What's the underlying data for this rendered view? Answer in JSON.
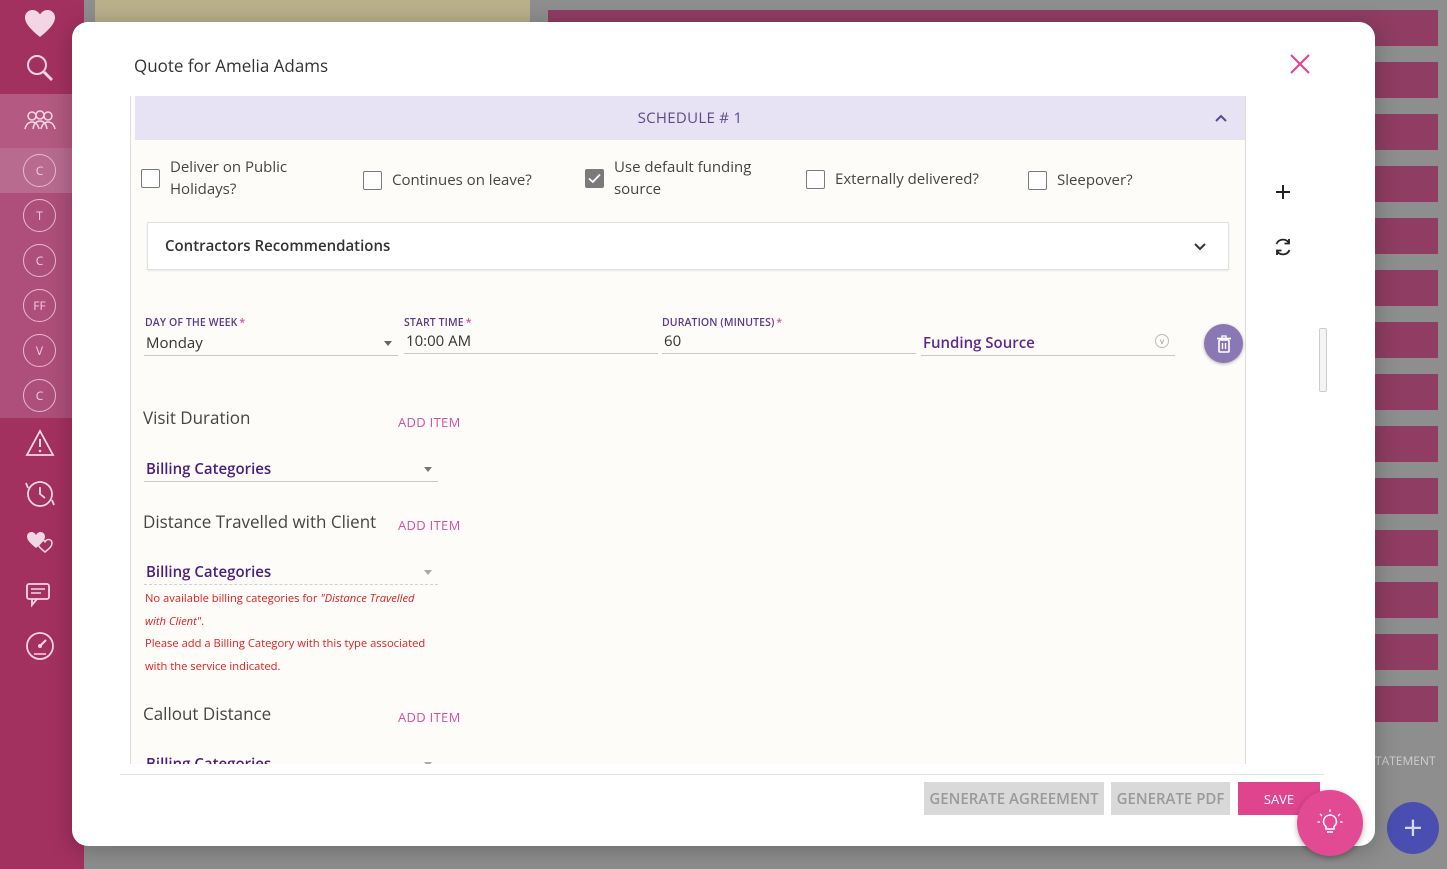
{
  "modal": {
    "title": "Quote for Amelia Adams"
  },
  "schedule": {
    "header": "SCHEDULE # 1",
    "checkboxes": [
      {
        "line1": "Deliver on Public",
        "line2": "Holidays?",
        "checked": false
      },
      {
        "line1": "Continues on leave?",
        "line2": "",
        "checked": false
      },
      {
        "line1": "Use default funding",
        "line2": "source",
        "checked": true
      },
      {
        "line1": "Externally delivered?",
        "line2": "",
        "checked": false
      },
      {
        "line1": "Sleepover?",
        "line2": "",
        "checked": false
      }
    ],
    "contractors_title": "Contractors Recommendations",
    "fields": {
      "day_label": "DAY OF THE WEEK",
      "day_value": "Monday",
      "start_label": "START TIME",
      "start_value": "10:00 AM",
      "duration_label": "DURATION (MINUTES)",
      "duration_value": "60",
      "funding_value": "Funding Source",
      "required_mark": "*"
    },
    "sections": [
      {
        "title": "Visit Duration",
        "add_item": "ADD ITEM",
        "billing": "Billing Categories"
      },
      {
        "title": "Distance Travelled with Client",
        "add_item": "ADD ITEM",
        "billing": "Billing Categories"
      },
      {
        "title": "Callout Distance",
        "add_item": "ADD ITEM",
        "billing": "Billing Categories"
      }
    ],
    "error": {
      "prefix": "No available billing categories for ",
      "emph_line1": "\"Distance Travelled",
      "emph_line2": "with Client\"",
      "suffix": ".",
      "line3": "Please add a Billing Category with this type associated",
      "line4": "with the service indicated."
    }
  },
  "footer": {
    "generate_agreement": "GENERATE AGREEMENT",
    "generate_pdf": "GENERATE PDF",
    "save": "SAVE"
  },
  "sidebar": {
    "client_initials": [
      "C",
      "T",
      "C",
      "FF",
      "V",
      "C"
    ]
  },
  "background": {
    "statement_text": "TATEMENT",
    "fab_plus": "+"
  },
  "colors": {
    "accent_pink": "#e0448e",
    "sidebar": "#a3315f",
    "schedule_header": "#e8e2f5",
    "purple_text": "#5b2a8a",
    "error_red": "#e02020"
  }
}
